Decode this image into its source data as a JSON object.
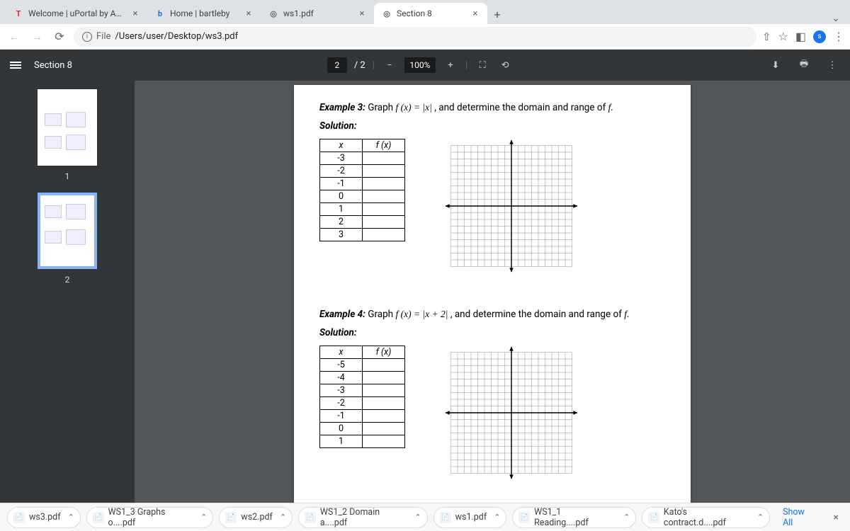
{
  "tabs": [
    {
      "label": "Welcome | uPortal by Apereo",
      "fav": "T",
      "favcolor": "#d93025"
    },
    {
      "label": "Home | bartleby",
      "fav": "b",
      "favcolor": "#1a73e8"
    },
    {
      "label": "ws1.pdf",
      "fav": "◎",
      "favcolor": "#5f6368"
    },
    {
      "label": "Section 8",
      "fav": "◎",
      "favcolor": "#5f6368",
      "active": true
    }
  ],
  "url": {
    "proto": "File",
    "path": "/Users/user/Desktop/ws3.pdf"
  },
  "pdf": {
    "title": "Section 8",
    "page_current": "2",
    "page_total": "/ 2",
    "zoom": "100%",
    "thumbs": [
      "1",
      "2"
    ],
    "example3": {
      "heading": "Example 3:",
      "prompt_pre": "Graph ",
      "func": "f (x) = |x|",
      "prompt_post": " , and determine the domain and range of ",
      "f": "f.",
      "solution": "Solution:",
      "th_x": "x",
      "th_fx": "f (x)",
      "rows": [
        "-3",
        "-2",
        "-1",
        "0",
        "1",
        "2",
        "3"
      ]
    },
    "example4": {
      "heading": "Example 4:",
      "prompt_pre": "Graph ",
      "func": "f (x) = |x + 2|",
      "prompt_post": " , and determine the domain and range of ",
      "f": "f.",
      "solution": "Solution:",
      "th_x": "x",
      "th_fx": "f (x)",
      "rows": [
        "-5",
        "-4",
        "-3",
        "-2",
        "-1",
        "0",
        "1"
      ]
    }
  },
  "downloads": [
    {
      "name": "ws3.pdf"
    },
    {
      "name": "WS1_3 Graphs o....pdf"
    },
    {
      "name": "ws2.pdf"
    },
    {
      "name": "WS1_2 Domain a....pdf"
    },
    {
      "name": "ws1.pdf"
    },
    {
      "name": "WS1_1 Reading....pdf"
    },
    {
      "name": "Kato's contract.d....pdf"
    }
  ],
  "dl_showall": "Show All"
}
